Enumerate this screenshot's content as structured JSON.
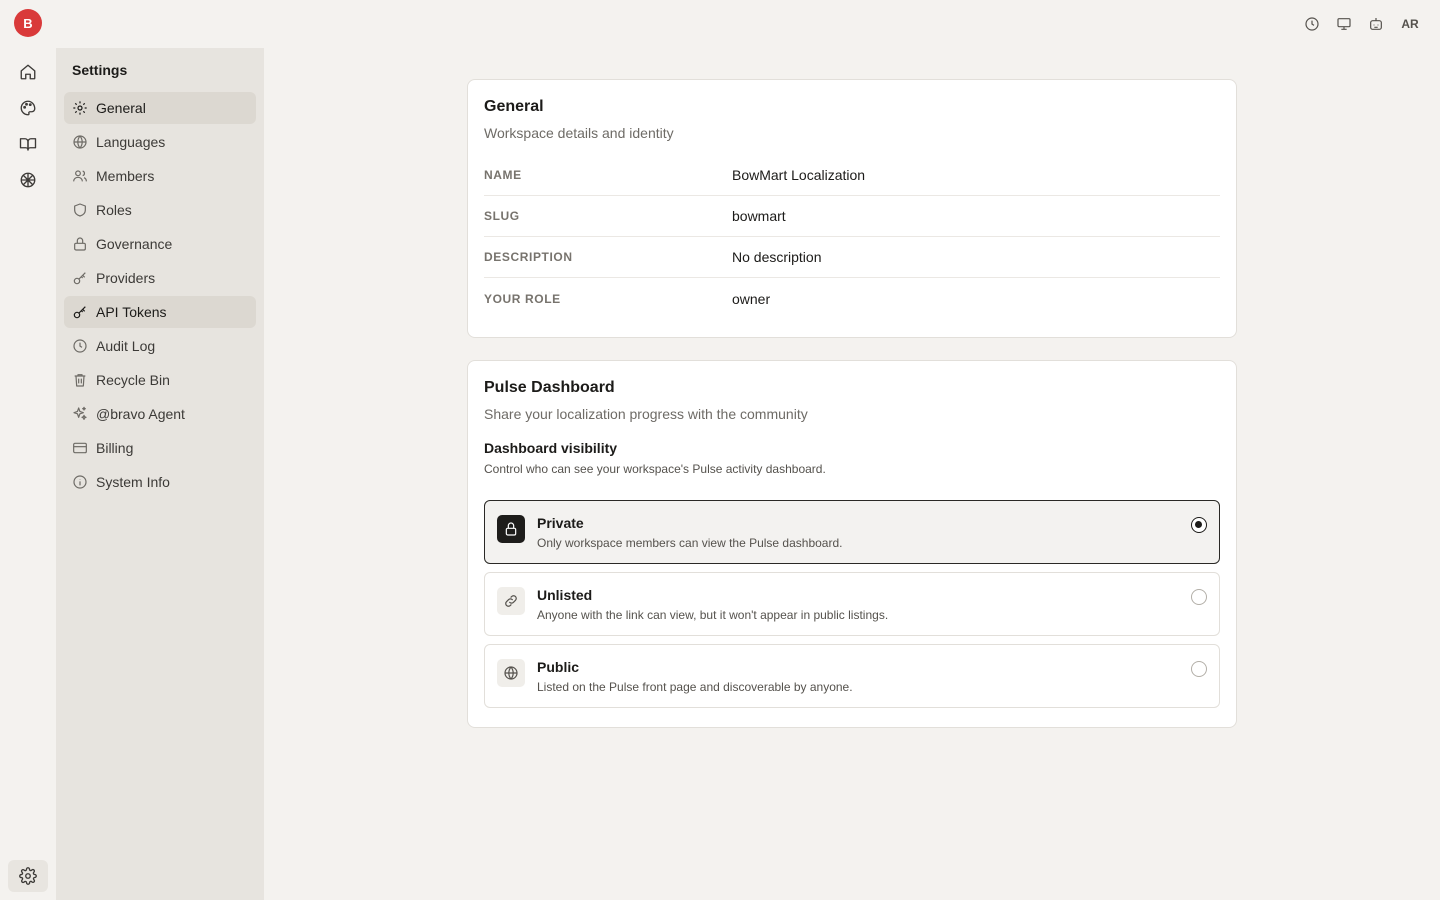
{
  "rail": {
    "logo_letter": "B",
    "icons": [
      "home-icon",
      "palette-icon",
      "book-icon",
      "brain-icon"
    ],
    "bottom_icon": "gear-icon"
  },
  "topbar": {
    "icons": [
      "clock-icon",
      "monitor-icon",
      "bot-icon"
    ],
    "avatar": "AR"
  },
  "sidebar": {
    "heading": "Settings",
    "items": [
      {
        "label": "General",
        "icon": "gear-icon",
        "state": "active"
      },
      {
        "label": "Languages",
        "icon": "globe-icon"
      },
      {
        "label": "Members",
        "icon": "users-icon"
      },
      {
        "label": "Roles",
        "icon": "shield-icon"
      },
      {
        "label": "Governance",
        "icon": "lock-icon"
      },
      {
        "label": "Providers",
        "icon": "key-icon"
      },
      {
        "label": "API Tokens",
        "icon": "key-icon",
        "state": "hover"
      },
      {
        "label": "Audit Log",
        "icon": "clock-icon"
      },
      {
        "label": "Recycle Bin",
        "icon": "trash-icon"
      },
      {
        "label": "@bravo Agent",
        "icon": "sparkles-icon"
      },
      {
        "label": "Billing",
        "icon": "credit-card-icon"
      },
      {
        "label": "System Info",
        "icon": "info-icon"
      }
    ]
  },
  "general": {
    "title": "General",
    "subtitle": "Workspace details and identity",
    "fields": [
      {
        "key": "NAME",
        "value": "BowMart Localization"
      },
      {
        "key": "SLUG",
        "value": "bowmart"
      },
      {
        "key": "DESCRIPTION",
        "value": "No description"
      },
      {
        "key": "YOUR ROLE",
        "value": "owner"
      }
    ]
  },
  "pulse": {
    "title": "Pulse Dashboard",
    "subtitle": "Share your localization progress with the community",
    "visibility_title": "Dashboard visibility",
    "visibility_desc": "Control who can see your workspace's Pulse activity dashboard.",
    "options": [
      {
        "label": "Private",
        "desc": "Only workspace members can view the Pulse dashboard.",
        "icon": "lock-icon",
        "selected": true
      },
      {
        "label": "Unlisted",
        "desc": "Anyone with the link can view, but it won't appear in public listings.",
        "icon": "link-icon",
        "selected": false
      },
      {
        "label": "Public",
        "desc": "Listed on the Pulse front page and discoverable by anyone.",
        "icon": "globe-icon",
        "selected": false
      }
    ]
  }
}
